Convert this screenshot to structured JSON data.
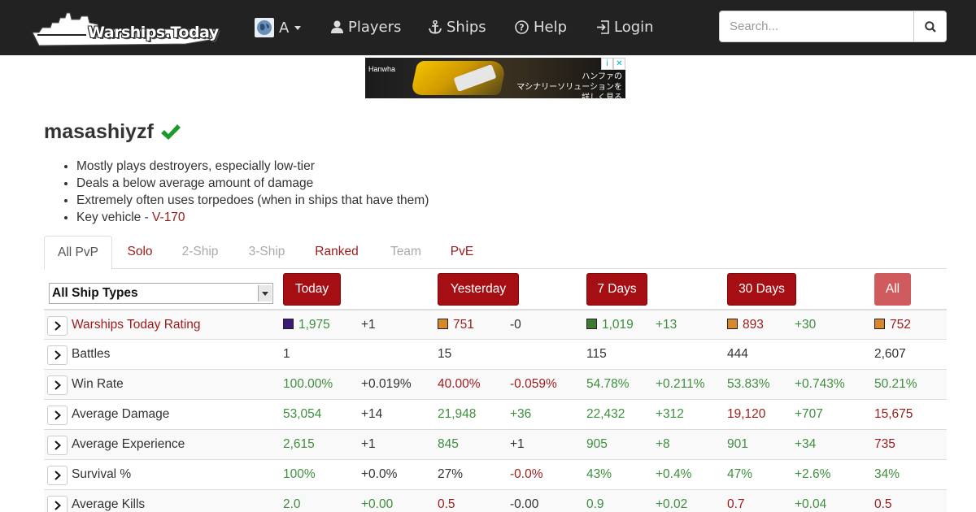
{
  "nav": {
    "brand": "Warships.Today",
    "region_label": "A",
    "players": "Players",
    "ships": "Ships",
    "help": "Help",
    "login": "Login",
    "search_placeholder": "Search..."
  },
  "ad": {
    "brand": "Hanwha",
    "text_line1": "ハンファの",
    "text_line2": "マシナリーソリューションを詳しく見る"
  },
  "player": {
    "name": "masashiyzf",
    "traits": [
      "Mostly plays destroyers, especially low-tier",
      "Deals a below average amount of damage",
      "Extremely often uses torpedoes (when in ships that have them)"
    ],
    "key_vehicle_prefix": "Key vehicle - ",
    "key_vehicle": "V-170"
  },
  "tabs": [
    "All PvP",
    "Solo",
    "2-Ship",
    "3-Ship",
    "Ranked",
    "Team",
    "PvE"
  ],
  "filter": {
    "ship_type": "All Ship Types"
  },
  "periods": [
    "Today",
    "Yesterday",
    "7 Days",
    "30 Days",
    "All"
  ],
  "colors": {
    "brand_red": "#a50f14",
    "good_green": "#3e8f3e",
    "bad_red": "#9b1b1b",
    "rating_super": "#3b1a78",
    "rating_bad": "#d8882a",
    "rating_avg": "#3e7a32"
  },
  "stats": [
    {
      "label": "Warships Today Rating",
      "cells": [
        {
          "v": "1,975",
          "c": "g",
          "sw": "#3b1a78"
        },
        {
          "v": "+1",
          "c": "k"
        },
        {
          "v": "751",
          "c": "r",
          "sw": "#d8882a"
        },
        {
          "v": "-0",
          "c": "k"
        },
        {
          "v": "1,019",
          "c": "g",
          "sw": "#3e7a32"
        },
        {
          "v": "+13",
          "c": "g"
        },
        {
          "v": "893",
          "c": "r",
          "sw": "#d8882a"
        },
        {
          "v": "+30",
          "c": "g"
        },
        {
          "v": "752",
          "c": "r",
          "sw": "#d8882a"
        }
      ]
    },
    {
      "label": "Battles",
      "cells": [
        {
          "v": "1",
          "c": "k"
        },
        {
          "v": "",
          "c": "k"
        },
        {
          "v": "15",
          "c": "k"
        },
        {
          "v": "",
          "c": "k"
        },
        {
          "v": "115",
          "c": "k"
        },
        {
          "v": "",
          "c": "k"
        },
        {
          "v": "444",
          "c": "k"
        },
        {
          "v": "",
          "c": "k"
        },
        {
          "v": "2,607",
          "c": "k"
        }
      ]
    },
    {
      "label": "Win Rate",
      "cells": [
        {
          "v": "100.00%",
          "c": "g"
        },
        {
          "v": "+0.019%",
          "c": "k"
        },
        {
          "v": "40.00%",
          "c": "r"
        },
        {
          "v": "-0.059%",
          "c": "r"
        },
        {
          "v": "54.78%",
          "c": "g"
        },
        {
          "v": "+0.211%",
          "c": "g"
        },
        {
          "v": "53.83%",
          "c": "g"
        },
        {
          "v": "+0.743%",
          "c": "g"
        },
        {
          "v": "50.21%",
          "c": "g"
        }
      ]
    },
    {
      "label": "Average Damage",
      "cells": [
        {
          "v": "53,054",
          "c": "g"
        },
        {
          "v": "+14",
          "c": "k"
        },
        {
          "v": "21,948",
          "c": "g"
        },
        {
          "v": "+36",
          "c": "g"
        },
        {
          "v": "22,432",
          "c": "g"
        },
        {
          "v": "+312",
          "c": "g"
        },
        {
          "v": "19,120",
          "c": "r"
        },
        {
          "v": "+707",
          "c": "g"
        },
        {
          "v": "15,675",
          "c": "r"
        }
      ]
    },
    {
      "label": "Average Experience",
      "cells": [
        {
          "v": "2,615",
          "c": "g"
        },
        {
          "v": "+1",
          "c": "k"
        },
        {
          "v": "845",
          "c": "g"
        },
        {
          "v": "+1",
          "c": "k"
        },
        {
          "v": "905",
          "c": "g"
        },
        {
          "v": "+8",
          "c": "g"
        },
        {
          "v": "901",
          "c": "g"
        },
        {
          "v": "+34",
          "c": "g"
        },
        {
          "v": "735",
          "c": "r"
        }
      ]
    },
    {
      "label": "Survival %",
      "cells": [
        {
          "v": "100%",
          "c": "g"
        },
        {
          "v": "+0.0%",
          "c": "k"
        },
        {
          "v": "27%",
          "c": "k"
        },
        {
          "v": "-0.0%",
          "c": "r"
        },
        {
          "v": "43%",
          "c": "g"
        },
        {
          "v": "+0.4%",
          "c": "g"
        },
        {
          "v": "47%",
          "c": "g"
        },
        {
          "v": "+2.6%",
          "c": "g"
        },
        {
          "v": "34%",
          "c": "g"
        }
      ]
    },
    {
      "label": "Average Kills",
      "cells": [
        {
          "v": "2.0",
          "c": "g"
        },
        {
          "v": "+0.00",
          "c": "g"
        },
        {
          "v": "0.5",
          "c": "r"
        },
        {
          "v": "-0.00",
          "c": "k"
        },
        {
          "v": "0.9",
          "c": "g"
        },
        {
          "v": "+0.02",
          "c": "g"
        },
        {
          "v": "0.7",
          "c": "r"
        },
        {
          "v": "+0.04",
          "c": "g"
        },
        {
          "v": "0.5",
          "c": "r"
        }
      ]
    }
  ]
}
